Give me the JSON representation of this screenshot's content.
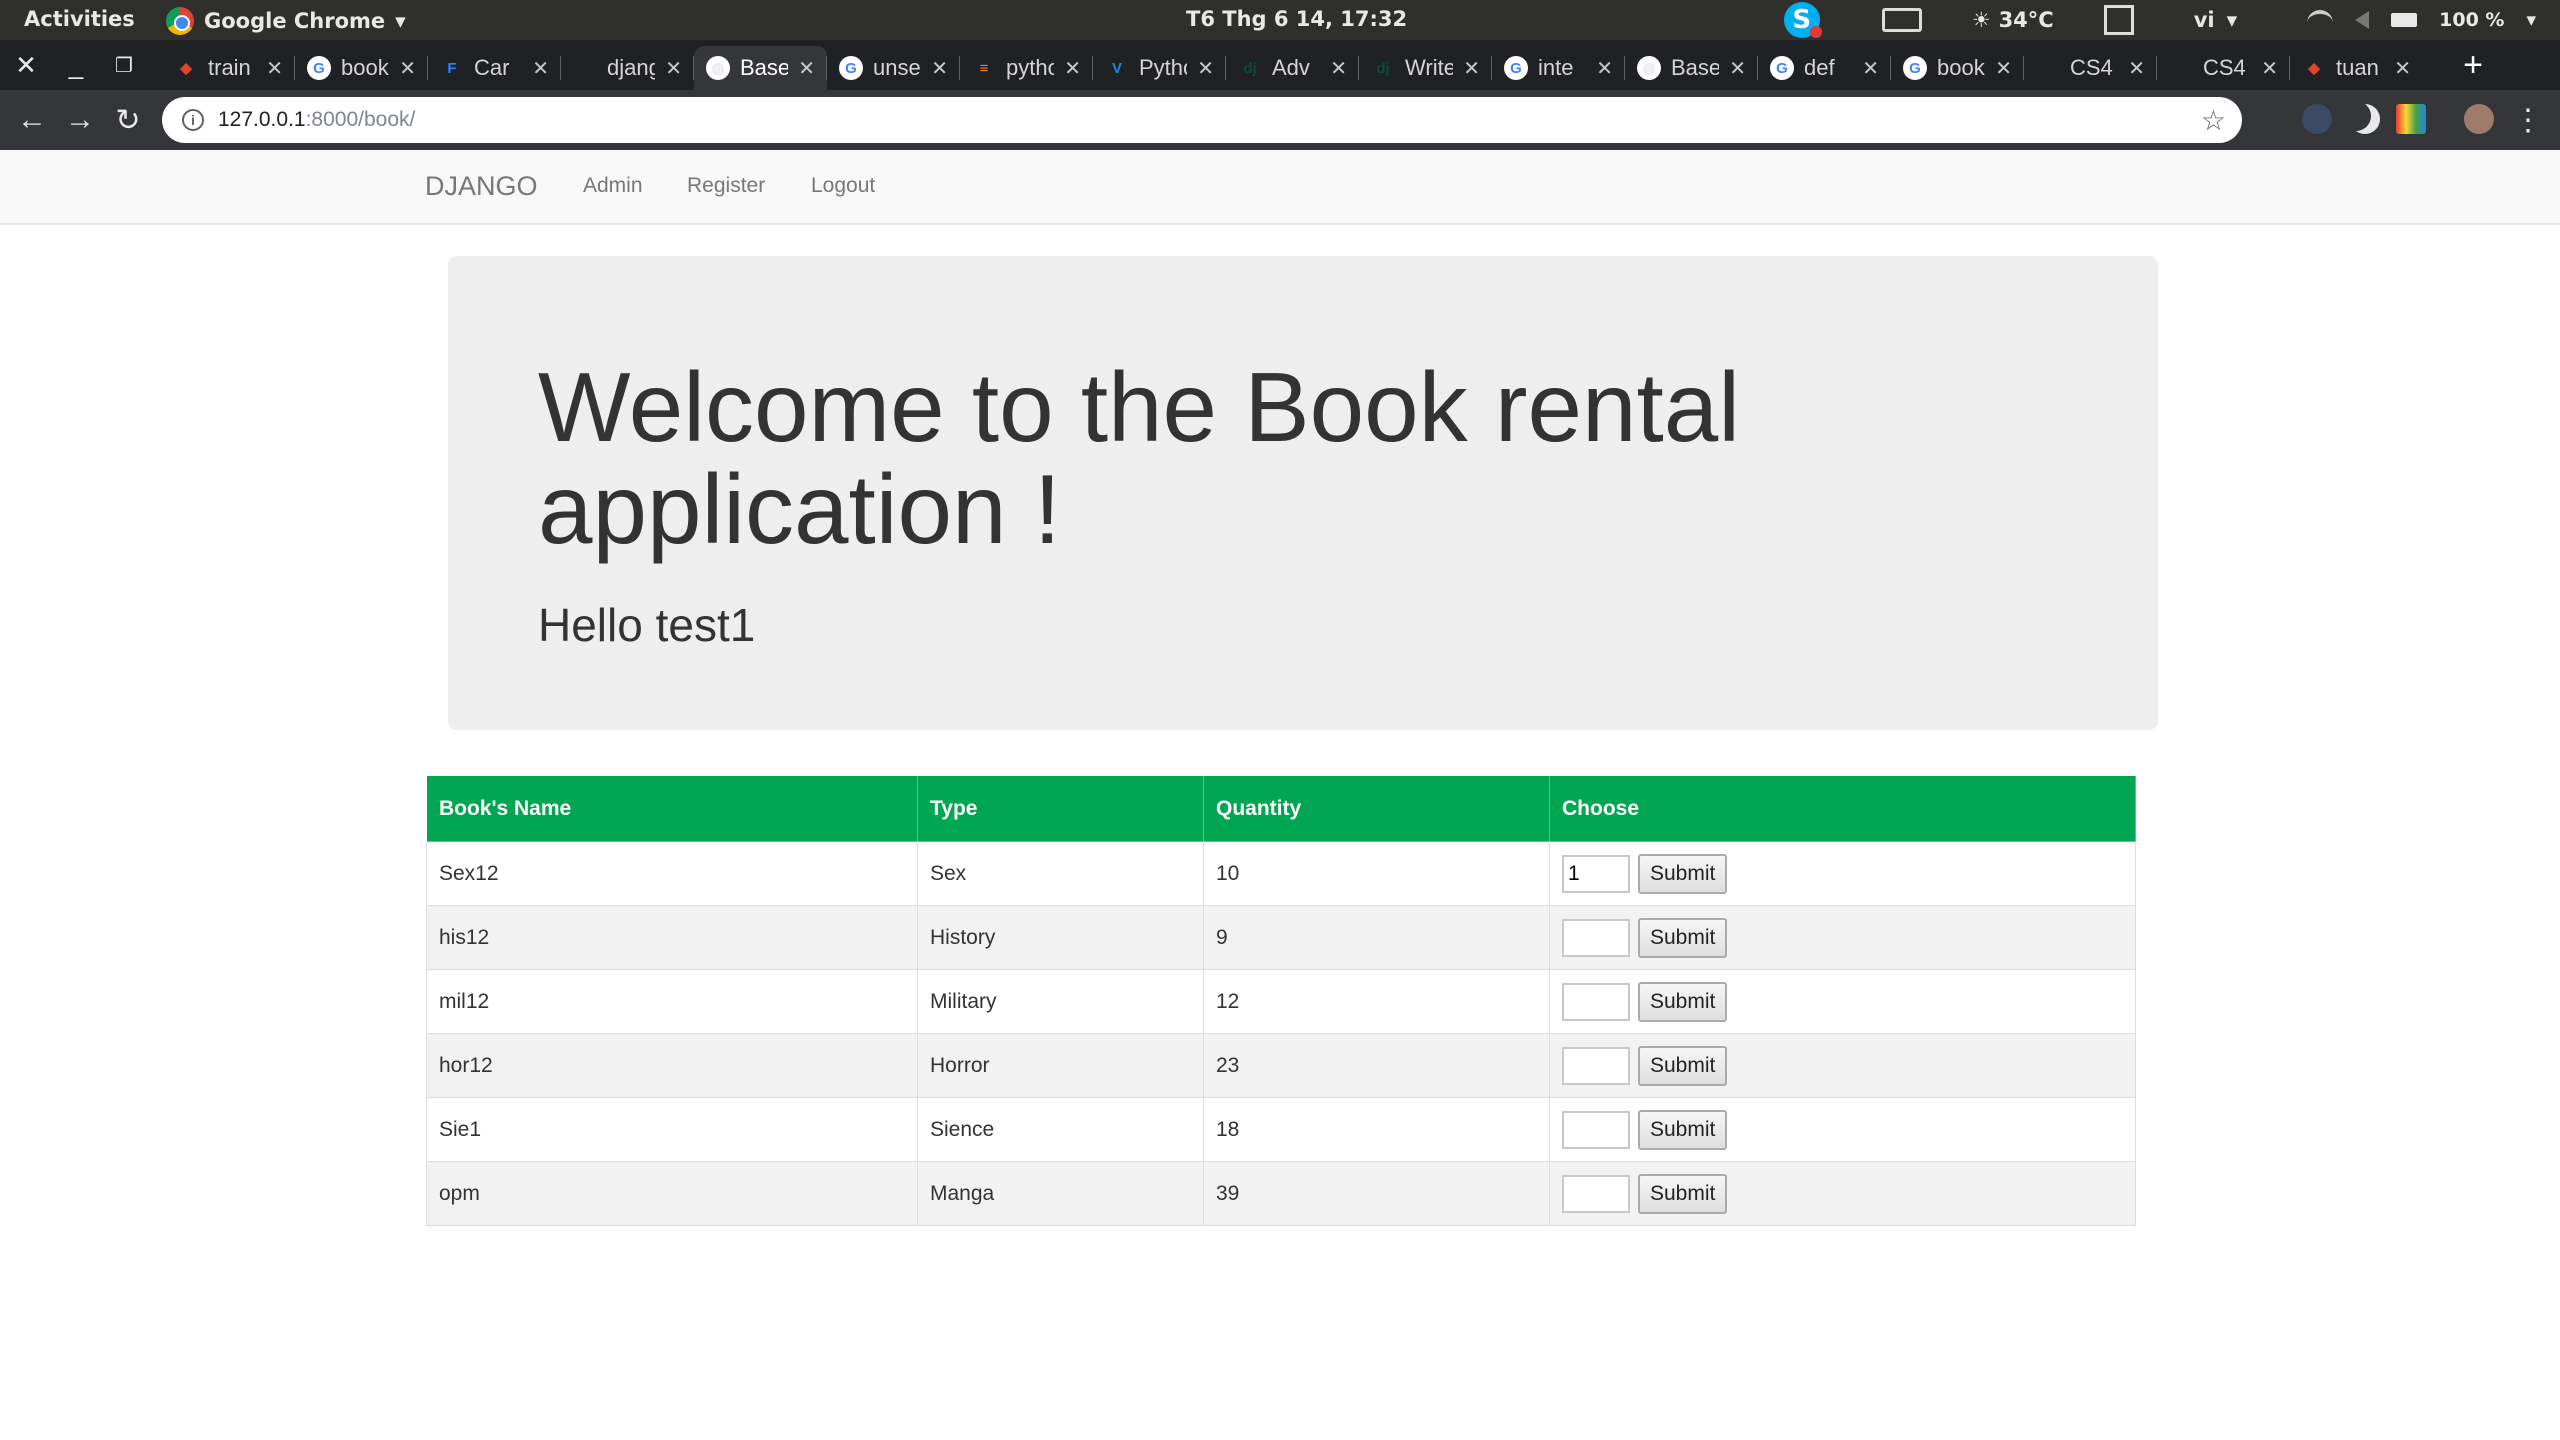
{
  "os_panel": {
    "activities": "Activities",
    "app_name": "Google Chrome",
    "clock": "T6 Thg 6 14, 17:32",
    "weather": "34°C",
    "language": "vi",
    "battery": "100 %"
  },
  "browser": {
    "tabs": [
      {
        "title": "train",
        "icon": "gitlab-icon",
        "color": "#e24329",
        "glyph": "◆"
      },
      {
        "title": "book",
        "icon": "google-icon",
        "color": "#4285f4",
        "glyph": "G"
      },
      {
        "title": "Car",
        "icon": "jira-icon",
        "color": "#2684ff",
        "glyph": "F"
      },
      {
        "title": "django",
        "icon": "django-icon",
        "color": "#202124",
        "glyph": ""
      },
      {
        "title": "Base",
        "icon": "globe-icon",
        "color": "#e8eaed",
        "glyph": "◍"
      },
      {
        "title": "unset",
        "icon": "google-icon",
        "color": "#4285f4",
        "glyph": "G"
      },
      {
        "title": "python",
        "icon": "stackoverflow-icon",
        "color": "#f48024",
        "glyph": "≡"
      },
      {
        "title": "Python",
        "icon": "vue-icon",
        "color": "#1e88e5",
        "glyph": "V"
      },
      {
        "title": "Adv",
        "icon": "django-icon",
        "color": "#0c4b33",
        "glyph": "dj"
      },
      {
        "title": "Write",
        "icon": "django-icon",
        "color": "#0c4b33",
        "glyph": "dj"
      },
      {
        "title": "inte",
        "icon": "google-icon",
        "color": "#4285f4",
        "glyph": "G"
      },
      {
        "title": "Base",
        "icon": "globe-icon",
        "color": "#e8eaed",
        "glyph": "◍"
      },
      {
        "title": "def",
        "icon": "google-icon",
        "color": "#4285f4",
        "glyph": "G"
      },
      {
        "title": "book",
        "icon": "google-icon",
        "color": "#4285f4",
        "glyph": "G"
      },
      {
        "title": "CS4",
        "icon": "blank-icon",
        "color": "#202124",
        "glyph": ""
      },
      {
        "title": "CS4",
        "icon": "blank-icon",
        "color": "#202124",
        "glyph": ""
      },
      {
        "title": "tuan",
        "icon": "gitlab-icon",
        "color": "#e24329",
        "glyph": "◆"
      }
    ],
    "active_tab": 4,
    "url_host": "127.0.0.1",
    "url_path": ":8000/book/"
  },
  "site": {
    "brand": "DJANGO",
    "nav": [
      "Admin",
      "Register",
      "Logout"
    ],
    "heading": "Welcome to the Book rental application !",
    "greeting": "Hello test1"
  },
  "table": {
    "headers": [
      "Book's Name",
      "Type",
      "Quantity",
      "Choose"
    ],
    "rows": [
      {
        "name": "Sex12",
        "type": "Sex",
        "quantity": "10",
        "choose_value": "1"
      },
      {
        "name": "his12",
        "type": "History",
        "quantity": "9",
        "choose_value": ""
      },
      {
        "name": "mil12",
        "type": "Military",
        "quantity": "12",
        "choose_value": ""
      },
      {
        "name": "hor12",
        "type": "Horror",
        "quantity": "23",
        "choose_value": ""
      },
      {
        "name": "Sie1",
        "type": "Sience",
        "quantity": "18",
        "choose_value": ""
      },
      {
        "name": "opm",
        "type": "Manga",
        "quantity": "39",
        "choose_value": ""
      }
    ],
    "submit_label": "Submit"
  },
  "colors": {
    "table_header": "#00a651",
    "jumbotron": "#eeeeee",
    "navbar": "#f8f8f8"
  }
}
